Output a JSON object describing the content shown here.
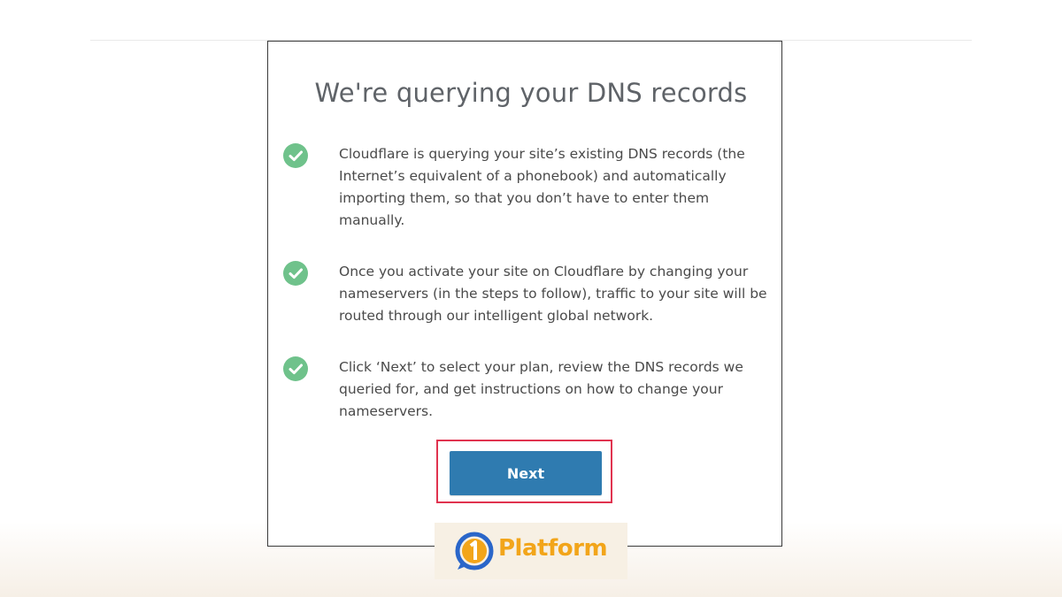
{
  "dialog": {
    "title": "We're querying your DNS records",
    "items": [
      {
        "icon": "check-circle-icon",
        "text": "Cloudflare is querying your site’s existing DNS records (the Internet’s equivalent of a phonebook) and automatically importing them, so that you don’t have to enter them manually."
      },
      {
        "icon": "check-circle-icon",
        "text": "Once you activate your site on Cloudflare by changing your nameservers (in the steps to follow), traffic to your site will be routed through our intelligent global network."
      },
      {
        "icon": "check-circle-icon",
        "text": "Click ‘Next’ to select your plan, review the DNS records we queried for, and get instructions on how to change your nameservers."
      }
    ],
    "next_label": "Next"
  },
  "watermark": {
    "brand_text": "Platform"
  },
  "colors": {
    "check_green": "#6fc28b",
    "button_blue": "#2f7bb0",
    "highlight_red": "#e0334f",
    "brand_orange": "#f2a51a",
    "heading_gray": "#5f6368"
  }
}
